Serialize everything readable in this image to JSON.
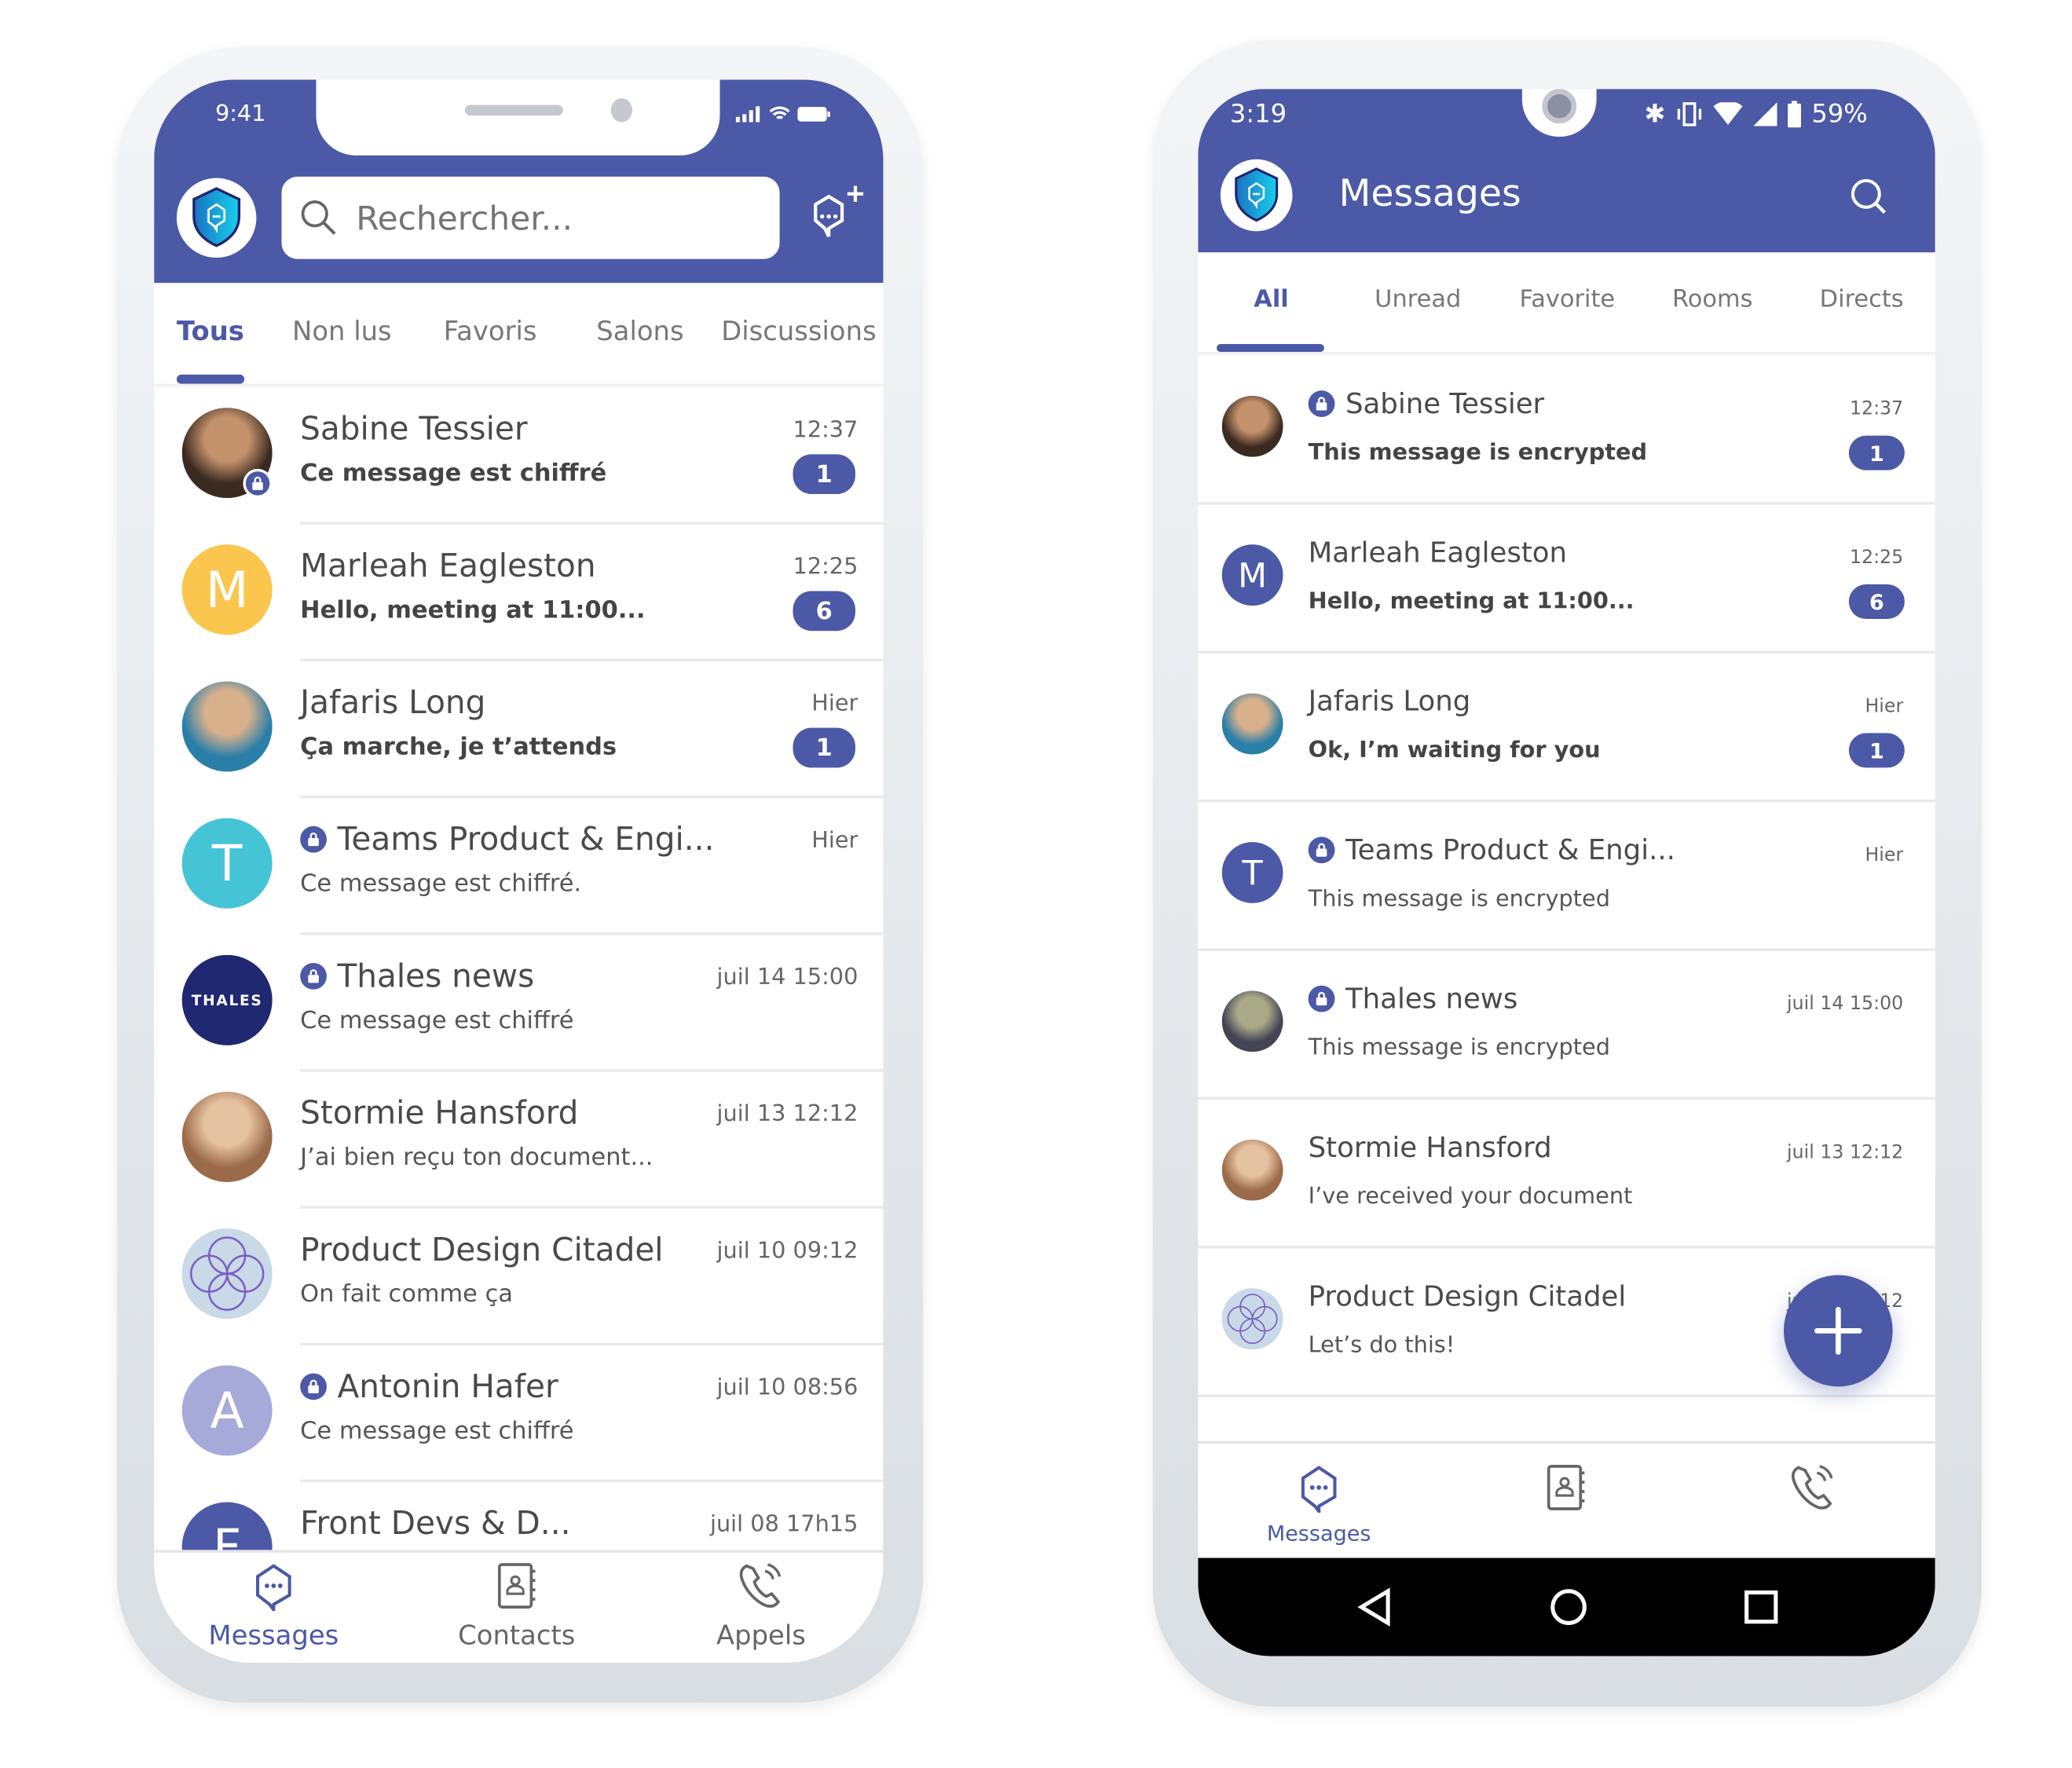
{
  "colors": {
    "accent": "#4b59a6",
    "badge": "#4b59a6"
  },
  "ios": {
    "status": {
      "time": "9:41"
    },
    "search": {
      "placeholder": "Rechercher..."
    },
    "tabs": [
      {
        "label": "Tous",
        "active": true
      },
      {
        "label": "Non lus"
      },
      {
        "label": "Favoris"
      },
      {
        "label": "Salons"
      },
      {
        "label": "Discussions"
      }
    ],
    "rows": [
      {
        "name": "Sabine Tessier",
        "message": "Ce message est chiffré",
        "time": "12:37",
        "badge": "1",
        "bold": true,
        "avatar": "photo",
        "lock_on_avatar": true
      },
      {
        "name": "Marleah Eagleston",
        "message": "Hello, meeting at 11:00...",
        "time": "12:25",
        "badge": "6",
        "bold": true,
        "avatar": "letter",
        "letter": "M",
        "color": "#fbc64e"
      },
      {
        "name": "Jafaris Long",
        "message": "Ça marche, je t’attends",
        "time": "Hier",
        "badge": "1",
        "bold": true,
        "avatar": "photo"
      },
      {
        "name": "Teams Product & Engi...",
        "message": "Ce message est chiffré.",
        "time": "Hier",
        "lock": true,
        "avatar": "letter",
        "letter": "T",
        "color": "#45c4d6"
      },
      {
        "name": "Thales news",
        "message": "Ce message est chiffré",
        "time": "juil 14 15:00",
        "lock": true,
        "avatar": "logo",
        "letter": "THALES",
        "color": "#1f2870"
      },
      {
        "name": "Stormie Hansford",
        "message": "J’ai bien reçu ton document...",
        "time": "juil 13 12:12",
        "avatar": "photo"
      },
      {
        "name": "Product Design Citadel",
        "message": "On fait comme ça",
        "time": "juil 10 09:12",
        "avatar": "pattern"
      },
      {
        "name": "Antonin Hafer",
        "message": "Ce message est chiffré",
        "time": "juil 10 08:56",
        "lock": true,
        "avatar": "letter",
        "letter": "A",
        "color": "#a5aad8"
      },
      {
        "name": "Front Devs & D...",
        "message": "",
        "time": "juil 08 17h15",
        "avatar": "letter",
        "letter": "F",
        "color": "#4b59a6"
      }
    ],
    "nav": [
      {
        "label": "Messages",
        "icon": "chat-icon",
        "active": true
      },
      {
        "label": "Contacts",
        "icon": "contacts-icon"
      },
      {
        "label": "Appels",
        "icon": "phone-icon"
      }
    ]
  },
  "android": {
    "status": {
      "time": "3:19",
      "battery": "59%"
    },
    "header": {
      "title": "Messages"
    },
    "tabs": [
      {
        "label": "All",
        "active": true
      },
      {
        "label": "Unread"
      },
      {
        "label": "Favorite"
      },
      {
        "label": "Rooms"
      },
      {
        "label": "Directs"
      }
    ],
    "rows": [
      {
        "name": "Sabine Tessier",
        "message": "This message is encrypted",
        "time": "12:37",
        "badge": "1",
        "bold": true,
        "lock": true,
        "avatar": "photo"
      },
      {
        "name": "Marleah Eagleston",
        "message": "Hello, meeting at 11:00...",
        "time": "12:25",
        "badge": "6",
        "bold": true,
        "avatar": "letter",
        "letter": "M",
        "color": "#4b59a6"
      },
      {
        "name": "Jafaris Long",
        "message": "Ok, I’m waiting for you",
        "time": "Hier",
        "badge": "1",
        "bold": true,
        "avatar": "photo"
      },
      {
        "name": "Teams Product & Engi...",
        "message": "This message is encrypted",
        "time": "Hier",
        "lock": true,
        "avatar": "letter",
        "letter": "T",
        "color": "#4b59a6"
      },
      {
        "name": "Thales news",
        "message": "This message is encrypted",
        "time": "juil 14 15:00",
        "lock": true,
        "avatar": "photo"
      },
      {
        "name": "Stormie Hansford",
        "message": "I’ve received your document",
        "time": "juil 13 12:12",
        "avatar": "photo"
      },
      {
        "name": "Product Design Citadel",
        "message": "Let’s do this!",
        "time": "juil 10 09:12",
        "avatar": "pattern"
      }
    ],
    "fab": {
      "icon": "plus-icon"
    },
    "nav": [
      {
        "label": "Messages",
        "icon": "chat-icon",
        "active": true
      },
      {
        "label": "",
        "icon": "contacts-icon"
      },
      {
        "label": "",
        "icon": "phone-icon"
      }
    ],
    "system_nav": [
      "back-icon",
      "home-icon",
      "recents-icon"
    ]
  }
}
